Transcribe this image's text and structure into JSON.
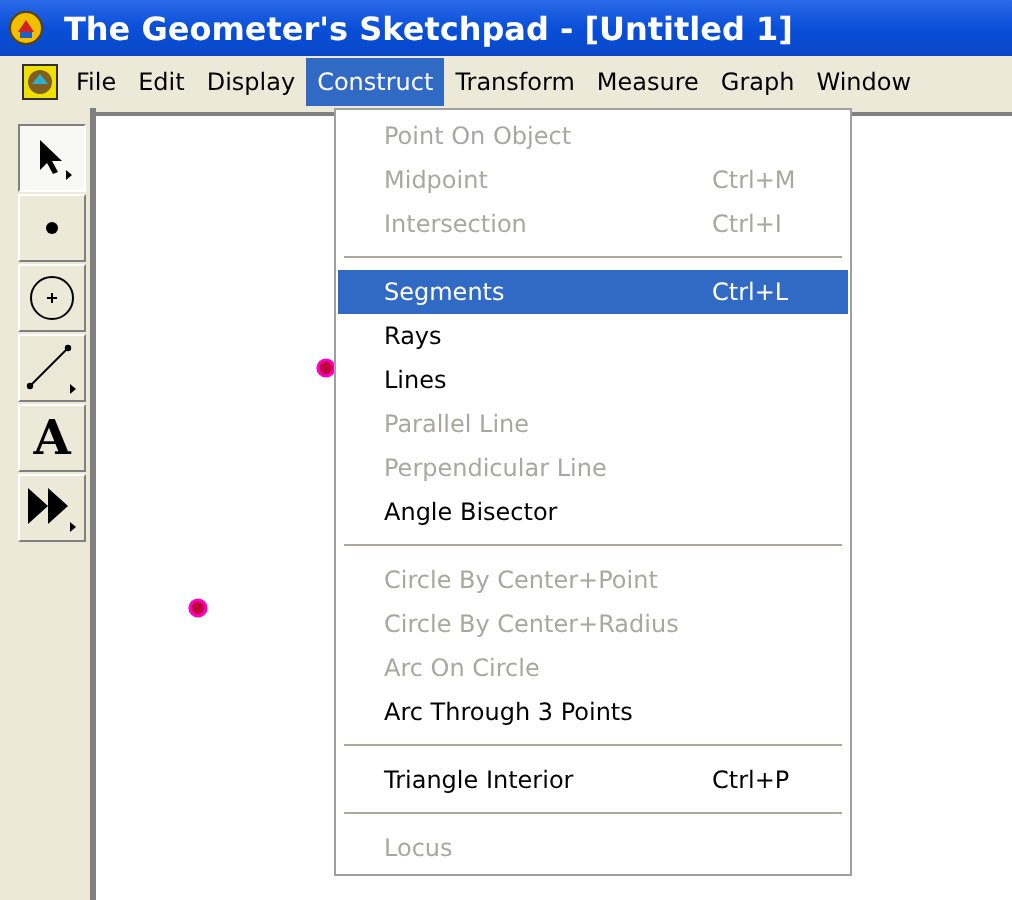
{
  "window": {
    "title": "The Geometer's Sketchpad - [Untitled 1]"
  },
  "menubar": [
    {
      "label": "File",
      "selected": false
    },
    {
      "label": "Edit",
      "selected": false
    },
    {
      "label": "Display",
      "selected": false
    },
    {
      "label": "Construct",
      "selected": true
    },
    {
      "label": "Transform",
      "selected": false
    },
    {
      "label": "Measure",
      "selected": false
    },
    {
      "label": "Graph",
      "selected": false
    },
    {
      "label": "Window",
      "selected": false
    }
  ],
  "tools": [
    {
      "kind": "arrow",
      "selected": true
    },
    {
      "kind": "point",
      "selected": false
    },
    {
      "kind": "compass",
      "selected": false
    },
    {
      "kind": "straightedge",
      "selected": false
    },
    {
      "kind": "text",
      "label": "A",
      "selected": false
    },
    {
      "kind": "custom",
      "selected": false
    }
  ],
  "menu": [
    {
      "kind": "item",
      "label": "Point On Object",
      "disabled": true,
      "selected": false
    },
    {
      "kind": "item",
      "label": "Midpoint",
      "shortcut": "Ctrl+M",
      "disabled": true,
      "selected": false
    },
    {
      "kind": "item",
      "label": "Intersection",
      "shortcut": "Ctrl+I",
      "disabled": true,
      "selected": false
    },
    {
      "kind": "separator"
    },
    {
      "kind": "item",
      "label": "Segments",
      "shortcut": "Ctrl+L",
      "disabled": false,
      "selected": true
    },
    {
      "kind": "item",
      "label": "Rays",
      "disabled": false,
      "selected": false
    },
    {
      "kind": "item",
      "label": "Lines",
      "disabled": false,
      "selected": false
    },
    {
      "kind": "item",
      "label": "Parallel Line",
      "disabled": true,
      "selected": false
    },
    {
      "kind": "item",
      "label": "Perpendicular Line",
      "disabled": true,
      "selected": false
    },
    {
      "kind": "item",
      "label": "Angle Bisector",
      "disabled": false,
      "selected": false
    },
    {
      "kind": "separator"
    },
    {
      "kind": "item",
      "label": "Circle By Center+Point",
      "disabled": true,
      "selected": false
    },
    {
      "kind": "item",
      "label": "Circle By Center+Radius",
      "disabled": true,
      "selected": false
    },
    {
      "kind": "item",
      "label": "Arc On Circle",
      "disabled": true,
      "selected": false
    },
    {
      "kind": "item",
      "label": "Arc Through 3 Points",
      "disabled": false,
      "selected": false
    },
    {
      "kind": "separator"
    },
    {
      "kind": "item",
      "label": "Triangle Interior",
      "shortcut": "Ctrl+P",
      "disabled": false,
      "selected": false
    },
    {
      "kind": "separator"
    },
    {
      "kind": "item",
      "label": "Locus",
      "disabled": true,
      "selected": false
    }
  ]
}
